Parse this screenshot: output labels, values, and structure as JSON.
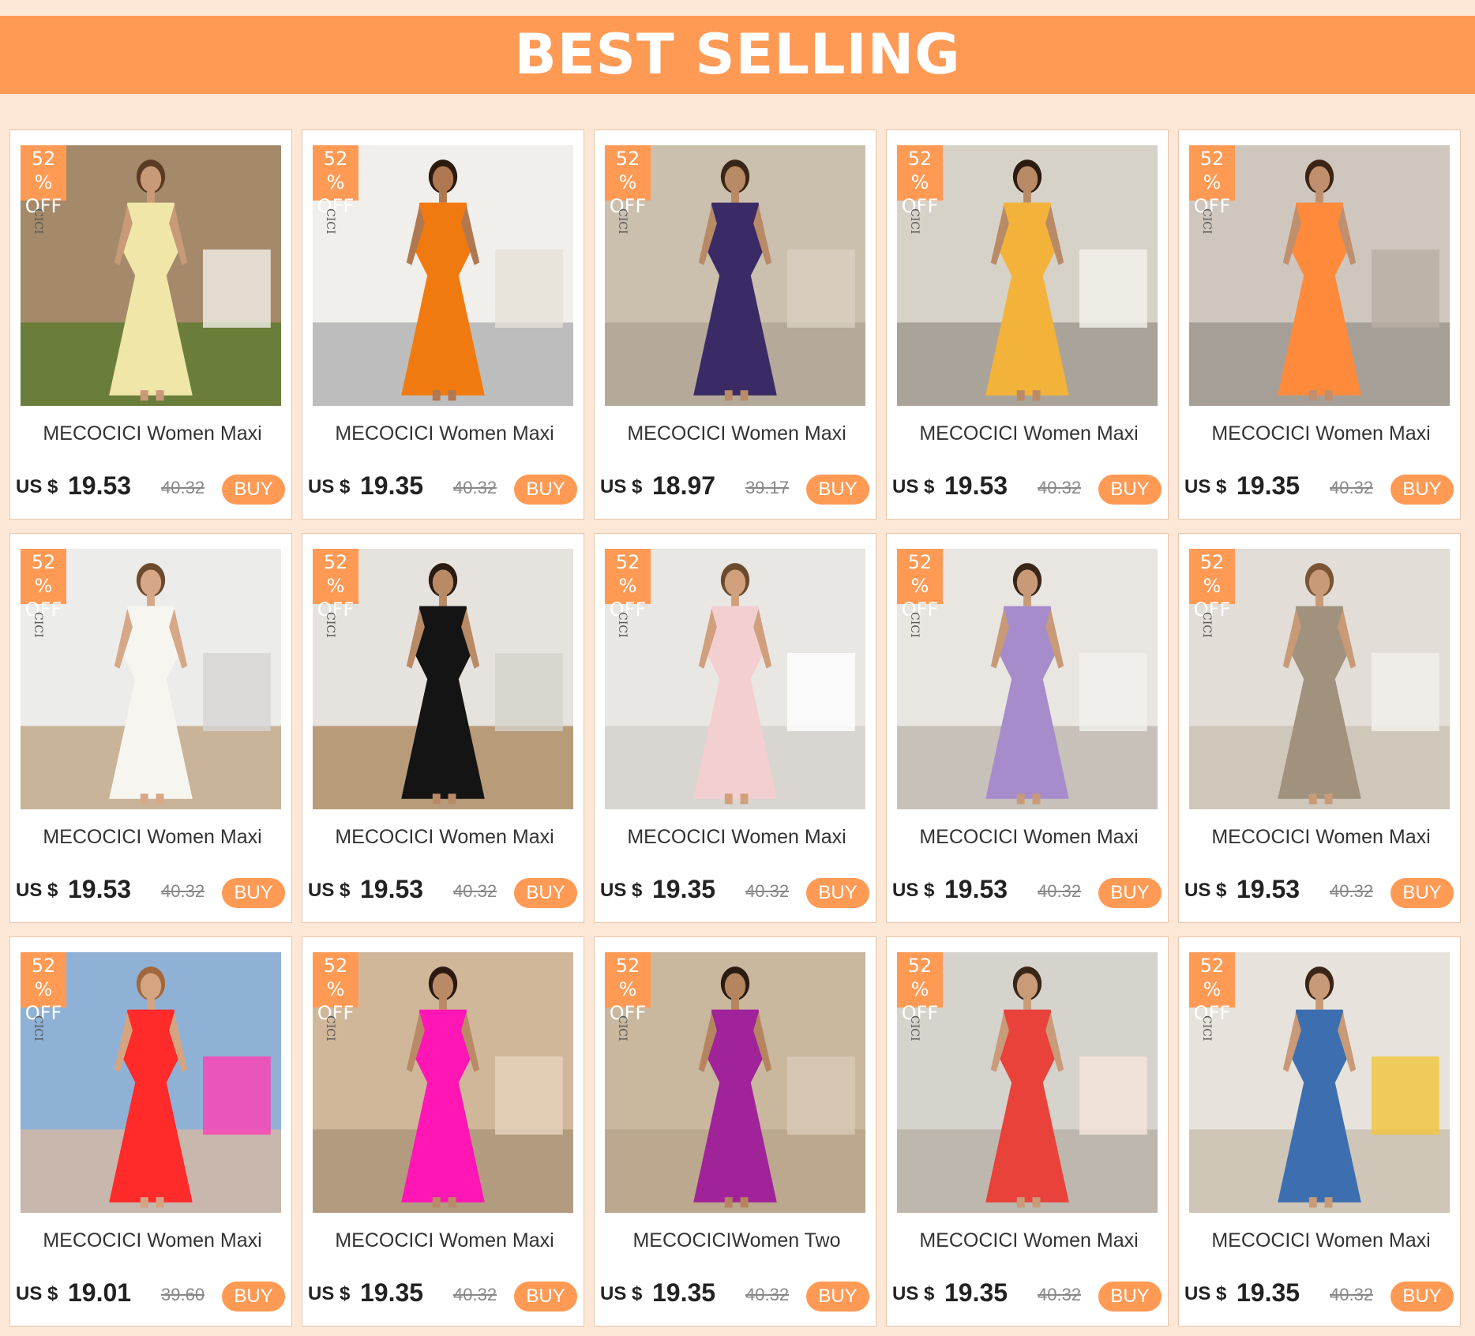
{
  "banner": {
    "title": "BEST SELLING"
  },
  "colors": {
    "accent": "#ff9a55",
    "background": "#fde7d6"
  },
  "products": [
    {
      "badge_pct": "52 %",
      "badge_off": "OFF",
      "title": "MECOCICI  Women Maxi Dress Summer Fashion",
      "currency": "US $",
      "price": "19.53",
      "old_price": "40.32",
      "buy_label": "BUY",
      "scene": {
        "bg": "#a48a6a",
        "floor": "#6b7d3a",
        "dress": "#efe6a8",
        "skin": "#c89a78",
        "hair": "#5a3a22",
        "accent": "#f2efe8"
      }
    },
    {
      "badge_pct": "52 %",
      "badge_off": "OFF",
      "title": "MECOCICI  Women Maxi Dress Fashion Solid Irregular",
      "currency": "US $",
      "price": "19.35",
      "old_price": "40.32",
      "buy_label": "BUY",
      "scene": {
        "bg": "#f1efeb",
        "floor": "#bdbdbd",
        "dress": "#f07a10",
        "skin": "#b07850",
        "hair": "#2c1a10",
        "accent": "#e6e1d8"
      }
    },
    {
      "badge_pct": "52 %",
      "badge_off": "OFF",
      "title": "MECOCICI  Women Maxi Dress Summer Fashion Sexy",
      "currency": "US $",
      "price": "18.97",
      "old_price": "39.17",
      "buy_label": "BUY",
      "scene": {
        "bg": "#cbbfae",
        "floor": "#b5aa9a",
        "dress": "#3a2b66",
        "skin": "#b98a66",
        "hair": "#3a2618",
        "accent": "#d9cfc0"
      }
    },
    {
      "badge_pct": "52 %",
      "badge_off": "OFF",
      "title": "MECOCICI  Women Maxi Dress Fashion Sexy Solid",
      "currency": "US $",
      "price": "19.53",
      "old_price": "40.32",
      "buy_label": "BUY",
      "scene": {
        "bg": "#d7d2c8",
        "floor": "#a9a39a",
        "dress": "#f3b23a",
        "skin": "#b98a66",
        "hair": "#2a1a10",
        "accent": "#f5f2ee"
      }
    },
    {
      "badge_pct": "52 %",
      "badge_off": "OFF",
      "title": "MECOCICI  Women Maxi Dress Summer Fashion Solid",
      "currency": "US $",
      "price": "19.35",
      "old_price": "40.32",
      "buy_label": "BUY",
      "scene": {
        "bg": "#cfc7be",
        "floor": "#a69f97",
        "dress": "#ff8a3c",
        "skin": "#c08f6d",
        "hair": "#3c2414",
        "accent": "#b9aea4"
      }
    },
    {
      "badge_pct": "52 %",
      "badge_off": "OFF",
      "title": "MECOCICI  Women Maxi Dress Fashion Sexy Round",
      "currency": "US $",
      "price": "19.53",
      "old_price": "40.32",
      "buy_label": "BUY",
      "scene": {
        "bg": "#ececea",
        "floor": "#c9b49a",
        "dress": "#f7f5f0",
        "skin": "#d6a888",
        "hair": "#6b4a2e",
        "accent": "#d8d6d3"
      }
    },
    {
      "badge_pct": "52 %",
      "badge_off": "OFF",
      "title": "MECOCICI  Women Maxi Dress Fashion Round Neck",
      "currency": "US $",
      "price": "19.53",
      "old_price": "40.32",
      "buy_label": "BUY",
      "scene": {
        "bg": "#e6e3de",
        "floor": "#b89c7a",
        "dress": "#141414",
        "skin": "#b98a66",
        "hair": "#2a1a10",
        "accent": "#d6d1ca"
      }
    },
    {
      "badge_pct": "52 %",
      "badge_off": "OFF",
      "title": "MECOCICI  Women Maxi Dress Summer Fashion",
      "currency": "US $",
      "price": "19.35",
      "old_price": "40.32",
      "buy_label": "BUY",
      "scene": {
        "bg": "#e9e7e4",
        "floor": "#d9d6d2",
        "dress": "#f4cfd2",
        "skin": "#d0a07c",
        "hair": "#6b4a2e",
        "accent": "#ffffff"
      }
    },
    {
      "badge_pct": "52 %",
      "badge_off": "OFF",
      "title": "MECOCICI  Women Maxi Dress Fashion Matching Tube",
      "currency": "US $",
      "price": "19.53",
      "old_price": "40.32",
      "buy_label": "BUY",
      "scene": {
        "bg": "#e9e6e1",
        "floor": "#c7c1b9",
        "dress": "#a78ccb",
        "skin": "#c89a78",
        "hair": "#3a2618",
        "accent": "#f3f1ee"
      }
    },
    {
      "badge_pct": "52 %",
      "badge_off": "OFF",
      "title": "MECOCICI  Women Maxi Dress Summer Fashion",
      "currency": "US $",
      "price": "19.53",
      "old_price": "40.32",
      "buy_label": "BUY",
      "scene": {
        "bg": "#e2ddd6",
        "floor": "#d0c7bb",
        "dress": "#a1927e",
        "skin": "#c89a78",
        "hair": "#7a5434",
        "accent": "#f4f1ec"
      }
    },
    {
      "badge_pct": "52 %",
      "badge_off": "OFF",
      "title": "MECOCICI  Women Maxi Dress Summer Fashion",
      "currency": "US $",
      "price": "19.01",
      "old_price": "39.60",
      "buy_label": "BUY",
      "scene": {
        "bg": "#8fb1d6",
        "floor": "#c7b7ad",
        "dress": "#ff2a2a",
        "skin": "#d5a581",
        "hair": "#a0683c",
        "accent": "#ff3fb4"
      }
    },
    {
      "badge_pct": "52 %",
      "badge_off": "OFF",
      "title": "MECOCICI  Women Maxi Dr Summer Fashion",
      "currency": "US $",
      "price": "19.35",
      "old_price": "40.32",
      "buy_label": "BUY",
      "scene": {
        "bg": "#d1b79a",
        "floor": "#b39b80",
        "dress": "#ff16b4",
        "skin": "#b98a66",
        "hair": "#2a1a10",
        "accent": "#e6d2bc"
      }
    },
    {
      "badge_pct": "52 %",
      "badge_off": "OFF",
      "title": "MECOCICIWomen    Two Piece Set Summer Fashion",
      "currency": "US $",
      "price": "19.35",
      "old_price": "40.32",
      "buy_label": "BUY",
      "scene": {
        "bg": "#c9b79e",
        "floor": "#bba88e",
        "dress": "#a0239a",
        "skin": "#b5855f",
        "hair": "#2a1a10",
        "accent": "#d9cbb8"
      }
    },
    {
      "badge_pct": "52 %",
      "badge_off": "OFF",
      "title": "MECOCICI  Women Maxi Dress Summer Fashion",
      "currency": "US $",
      "price": "19.35",
      "old_price": "40.32",
      "buy_label": "BUY",
      "scene": {
        "bg": "#d6d2cc",
        "floor": "#bdb7ae",
        "dress": "#e8423a",
        "skin": "#c99b78",
        "hair": "#3a2618",
        "accent": "#f6e6dc"
      }
    },
    {
      "badge_pct": "52 %",
      "badge_off": "OFF",
      "title": "MECOCICI  Women Maxi Dress Fashion Casual Round",
      "currency": "US $",
      "price": "19.35",
      "old_price": "40.32",
      "buy_label": "BUY",
      "scene": {
        "bg": "#e7e3dc",
        "floor": "#cfc6b8",
        "dress": "#3d6fb0",
        "skin": "#c89a78",
        "hair": "#3a2618",
        "accent": "#f1c43c"
      }
    }
  ]
}
